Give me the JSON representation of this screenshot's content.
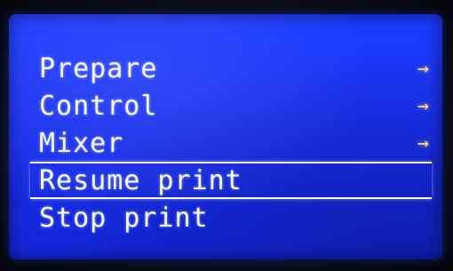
{
  "menu": {
    "items": [
      {
        "label": "Prepare",
        "has_submenu": true,
        "arrow": "→"
      },
      {
        "label": "Control",
        "has_submenu": true,
        "arrow": "→"
      },
      {
        "label": "Mixer",
        "has_submenu": true,
        "arrow": "→"
      },
      {
        "label": "Resume print",
        "has_submenu": false,
        "selected": true
      },
      {
        "label": "Stop print",
        "has_submenu": false
      }
    ]
  },
  "colors": {
    "screen_background": "#1830ee",
    "text": "#f2f6ff",
    "arrow": "#ffd08a"
  }
}
